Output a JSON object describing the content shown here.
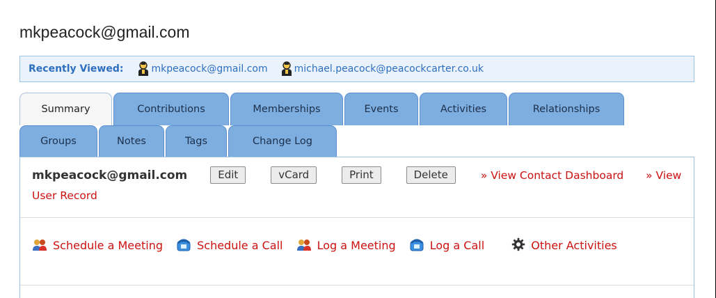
{
  "page_title": "mkpeacock@gmail.com",
  "recently_viewed": {
    "label": "Recently Viewed:",
    "items": [
      {
        "label": "mkpeacock@gmail.com",
        "icon": "person-icon"
      },
      {
        "label": "michael.peacock@peacockcarter.co.uk",
        "icon": "person-icon"
      }
    ]
  },
  "tabs": {
    "row1": [
      {
        "label": "Summary",
        "active": true
      },
      {
        "label": "Contributions"
      },
      {
        "label": "Memberships"
      },
      {
        "label": "Events"
      },
      {
        "label": "Activities"
      },
      {
        "label": "Relationships"
      }
    ],
    "row2": [
      {
        "label": "Groups"
      },
      {
        "label": "Notes"
      },
      {
        "label": "Tags"
      },
      {
        "label": "Change Log"
      }
    ]
  },
  "contact": {
    "name": "mkpeacock@gmail.com",
    "buttons": {
      "edit": "Edit",
      "vcard": "vCard",
      "print": "Print",
      "delete": "Delete"
    },
    "links": {
      "view_dashboard": "» View Contact Dashboard",
      "view_user_record": "» View User Record"
    }
  },
  "activities": {
    "schedule_meeting": "Schedule a Meeting",
    "schedule_call": "Schedule a Call",
    "log_meeting": "Log a Meeting",
    "log_call": "Log a Call",
    "other": "Other Activities"
  },
  "colors": {
    "link_blue": "#2e6fbf",
    "link_red": "#cc1111",
    "tab_blue": "#7eaee0",
    "panel_border": "#9ec2e6"
  }
}
